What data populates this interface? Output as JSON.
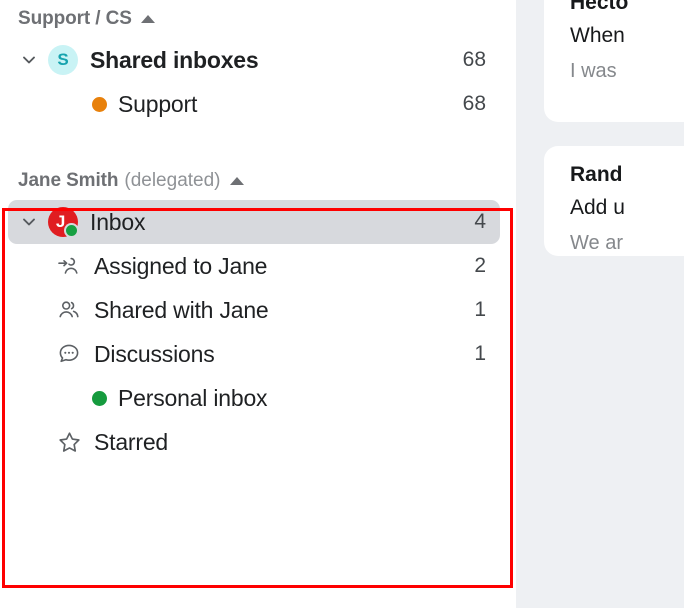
{
  "sidebar": {
    "groups": [
      {
        "id": "support-cs",
        "title": "Support / CS",
        "subtitle": "",
        "collapse_icon": "caret-up-icon",
        "rows": [
          {
            "id": "shared-inboxes",
            "label": "Shared inboxes",
            "count": "68",
            "avatar_letter": "S",
            "avatar_color": "#c9f3f5",
            "avatar_text_color": "#16a3ae",
            "chevron": "chevron-down-icon",
            "selected": false
          },
          {
            "id": "support",
            "label": "Support",
            "count": "68",
            "dot_color": "#e8810c",
            "selected": false
          }
        ]
      },
      {
        "id": "jane-smith",
        "title": "Jane Smith",
        "subtitle": "(delegated)",
        "collapse_icon": "caret-up-icon",
        "rows": [
          {
            "id": "inbox",
            "label": "Inbox",
            "count": "4",
            "avatar_letter": "J.",
            "avatar_color": "#e01d21",
            "avatar_text_color": "#ffffff",
            "presence_color": "#17a042",
            "chevron": "chevron-down-icon",
            "selected": true
          },
          {
            "id": "assigned-to-jane",
            "label": "Assigned to Jane",
            "count": "2",
            "icon": "assigned-person-icon",
            "selected": false
          },
          {
            "id": "shared-with-jane",
            "label": "Shared with Jane",
            "count": "1",
            "icon": "people-icon",
            "selected": false
          },
          {
            "id": "discussions",
            "label": "Discussions",
            "count": "1",
            "icon": "chat-bubble-icon",
            "selected": false
          },
          {
            "id": "personal-inbox",
            "label": "Personal inbox",
            "count": "",
            "dot_color": "#169b3e",
            "selected": false
          },
          {
            "id": "starred",
            "label": "Starred",
            "count": "",
            "icon": "star-icon",
            "selected": false
          }
        ]
      }
    ],
    "highlight_color": "#fe0000"
  },
  "conversation_list": {
    "background": "#eef0f3",
    "cards": [
      {
        "sender": "Hecto",
        "subject": "When",
        "preview": "I was"
      },
      {
        "sender": "Rand",
        "subject": "Add u",
        "preview": "We ar"
      }
    ]
  }
}
